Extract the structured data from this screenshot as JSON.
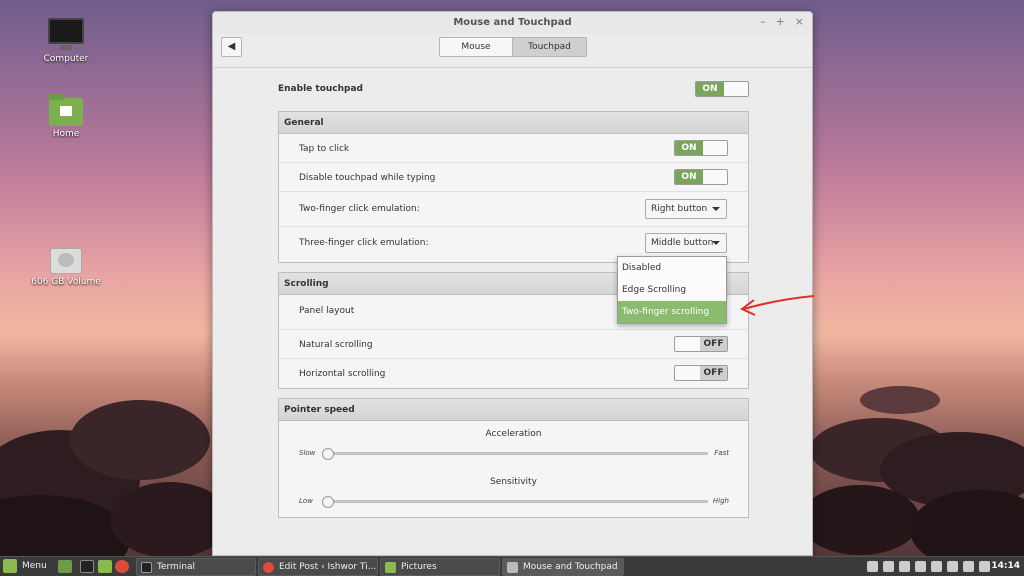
{
  "desktop": {
    "icons": [
      {
        "label": "Computer"
      },
      {
        "label": "Home"
      },
      {
        "label": "606 GB Volume"
      }
    ]
  },
  "window": {
    "title": "Mouse and Touchpad",
    "back_icon": "arrow-left-icon",
    "tabs": [
      {
        "label": "Mouse",
        "active": false
      },
      {
        "label": "Touchpad",
        "active": true
      }
    ],
    "enable_touchpad": {
      "label": "Enable touchpad",
      "state": "ON"
    },
    "general": {
      "title": "General",
      "tap_to_click": {
        "label": "Tap to click",
        "state": "ON"
      },
      "disable_while_typing": {
        "label": "Disable touchpad while typing",
        "state": "ON"
      },
      "two_finger_click": {
        "label": "Two-finger click emulation:",
        "value": "Right button"
      },
      "three_finger_click": {
        "label": "Three-finger click emulation:",
        "value": "Middle button"
      }
    },
    "scrolling": {
      "title": "Scrolling",
      "panel_layout": {
        "label": "Panel layout"
      },
      "natural_scrolling": {
        "label": "Natural scrolling",
        "state": "OFF"
      },
      "horizontal_scrolling": {
        "label": "Horizontal scrolling",
        "state": "OFF"
      }
    },
    "pointer_speed": {
      "title": "Pointer speed",
      "acceleration": {
        "label": "Acceleration",
        "min": "Slow",
        "max": "Fast",
        "value": 0.0
      },
      "sensitivity": {
        "label": "Sensitivity",
        "min": "Low",
        "max": "High",
        "value": 0.0
      }
    }
  },
  "dropdown": {
    "options": [
      "Disabled",
      "Edge Scrolling",
      "Two-finger scrolling"
    ],
    "selected_index": 2
  },
  "taskbar": {
    "menu_label": "Menu",
    "tasks": [
      "Terminal",
      "Edit Post ‹ Ishwor Ti...",
      "Pictures",
      "Mouse and Touchpad"
    ],
    "clock": "14:14"
  },
  "colors": {
    "accent_green": "#7aa65b",
    "selected_green": "#8bbb6e",
    "annotation_red": "#e0302a"
  }
}
